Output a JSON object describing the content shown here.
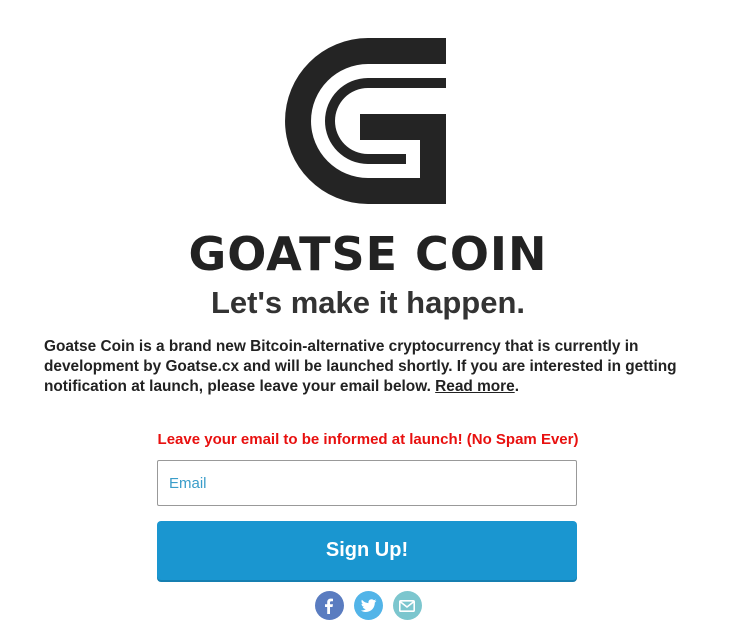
{
  "brand": {
    "name": "GOATSE COIN",
    "tagline": "Let's make it happen."
  },
  "intro": {
    "text": "Goatse Coin is a brand new Bitcoin-alternative cryptocurrency that is currently in development by Goatse.cx and will be launched shortly. If you are interested in getting notification at launch, please leave your email below. ",
    "read_more_label": "Read more",
    "trailing": "."
  },
  "signup": {
    "notice": "Leave your email to be informed at launch! (No Spam Ever)",
    "email_placeholder": "Email",
    "email_value": "",
    "button_label": "Sign Up!"
  },
  "social": [
    {
      "name": "facebook-icon",
      "color": "#5a7cc0"
    },
    {
      "name": "twitter-icon",
      "color": "#52b4e8"
    },
    {
      "name": "mail-icon",
      "color": "#7cc6ce"
    }
  ],
  "colors": {
    "accent": "#1a96d0",
    "notice": "#e8100f",
    "text": "#222222"
  }
}
